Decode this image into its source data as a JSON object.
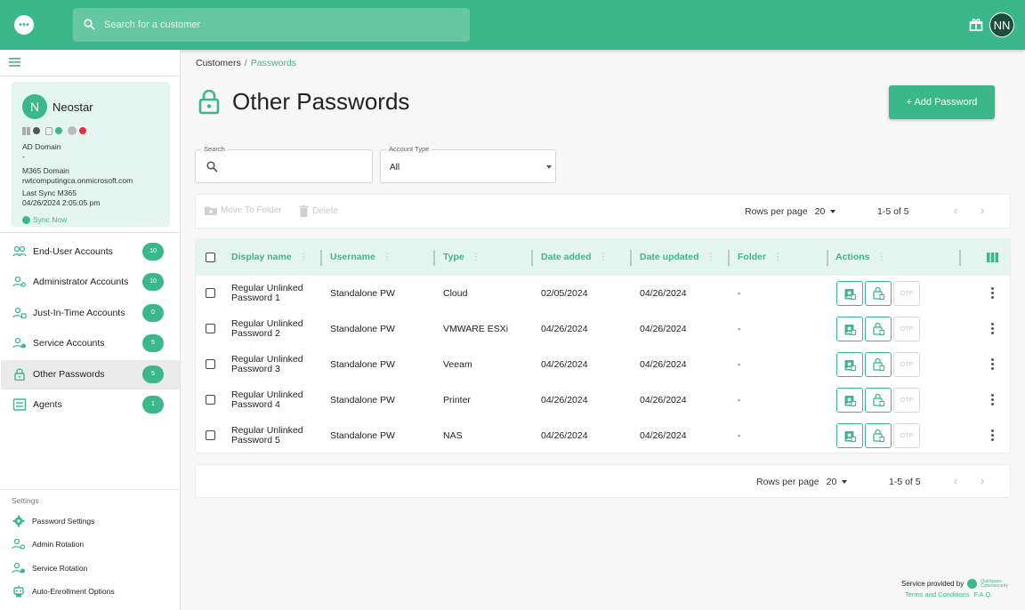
{
  "header": {
    "search_placeholder": "Search for a customer",
    "user_initials": "NN"
  },
  "customer": {
    "initial": "N",
    "name": "Neostar",
    "ad_domain_label": "AD Domain",
    "ad_domain_value": "-",
    "m365_domain_label": "M365 Domain",
    "m365_domain_value": "rwtcomputingca.onmicrosoft.com",
    "last_sync_label": "Last Sync M365",
    "last_sync_value": "04/26/2024 2:05:05 pm",
    "sync_now": "Sync Now"
  },
  "nav": {
    "items": [
      {
        "label": "End-User Accounts",
        "count": "10"
      },
      {
        "label": "Administrator Accounts",
        "count": "10"
      },
      {
        "label": "Just-In-Time Accounts",
        "count": "0"
      },
      {
        "label": "Service Accounts",
        "count": "5"
      },
      {
        "label": "Other Passwords",
        "count": "5"
      },
      {
        "label": "Agents",
        "count": "1"
      }
    ]
  },
  "settings": {
    "title": "Settings",
    "items": [
      {
        "label": "Password Settings"
      },
      {
        "label": "Admin Rotation"
      },
      {
        "label": "Service Rotation"
      },
      {
        "label": "Auto-Enrollment Options"
      }
    ]
  },
  "breadcrumb": {
    "parent": "Customers",
    "separator": "/",
    "current": "Passwords"
  },
  "page": {
    "title": "Other Passwords",
    "add_button": "+ Add Password"
  },
  "filters": {
    "search_label": "Search",
    "account_type_label": "Account Type",
    "account_type_value": "All"
  },
  "toolbar": {
    "move_to_folder": "Move To Folder",
    "delete": "Delete",
    "rows_per_page_label": "Rows per page",
    "rows_per_page_value": "20",
    "range": "1-5 of 5"
  },
  "table": {
    "columns": [
      "Display name",
      "Username",
      "Type",
      "Date added",
      "Date updated",
      "Folder",
      "Actions"
    ],
    "rows": [
      {
        "name_line1": "Regular Unlinked",
        "name_line2": "Password 1",
        "username": "Standalone PW",
        "type": "Cloud",
        "date_added": "02/05/2024",
        "date_updated": "04/26/2024",
        "folder": "-",
        "otp": "OTP"
      },
      {
        "name_line1": "Regular Unlinked",
        "name_line2": "Password 2",
        "username": "Standalone PW",
        "type": "VMWARE ESXi",
        "date_added": "04/26/2024",
        "date_updated": "04/26/2024",
        "folder": "-",
        "otp": "OTP"
      },
      {
        "name_line1": "Regular Unlinked",
        "name_line2": "Password 3",
        "username": "Standalone PW",
        "type": "Veeam",
        "date_added": "04/26/2024",
        "date_updated": "04/26/2024",
        "folder": "-",
        "otp": "OTP"
      },
      {
        "name_line1": "Regular Unlinked",
        "name_line2": "Password 4",
        "username": "Standalone PW",
        "type": "Printer",
        "date_added": "04/26/2024",
        "date_updated": "04/26/2024",
        "folder": "-",
        "otp": "OTP"
      },
      {
        "name_line1": "Regular Unlinked",
        "name_line2": "Password 5",
        "username": "Standalone PW",
        "type": "NAS",
        "date_added": "04/26/2024",
        "date_updated": "04/26/2024",
        "folder": "-",
        "otp": "OTP"
      }
    ]
  },
  "footer": {
    "provided_by": "Service provided by",
    "brand_line1": "Quickpass",
    "brand_line2": "Cybersecurity",
    "terms": "Terms and Conditions",
    "faq": "F.A.Q."
  },
  "colors": {
    "accent": "#3bb88b",
    "accent_light": "#e3f5ee",
    "avatar_dark": "#1d4d3e",
    "status_red": "#e8303a"
  }
}
